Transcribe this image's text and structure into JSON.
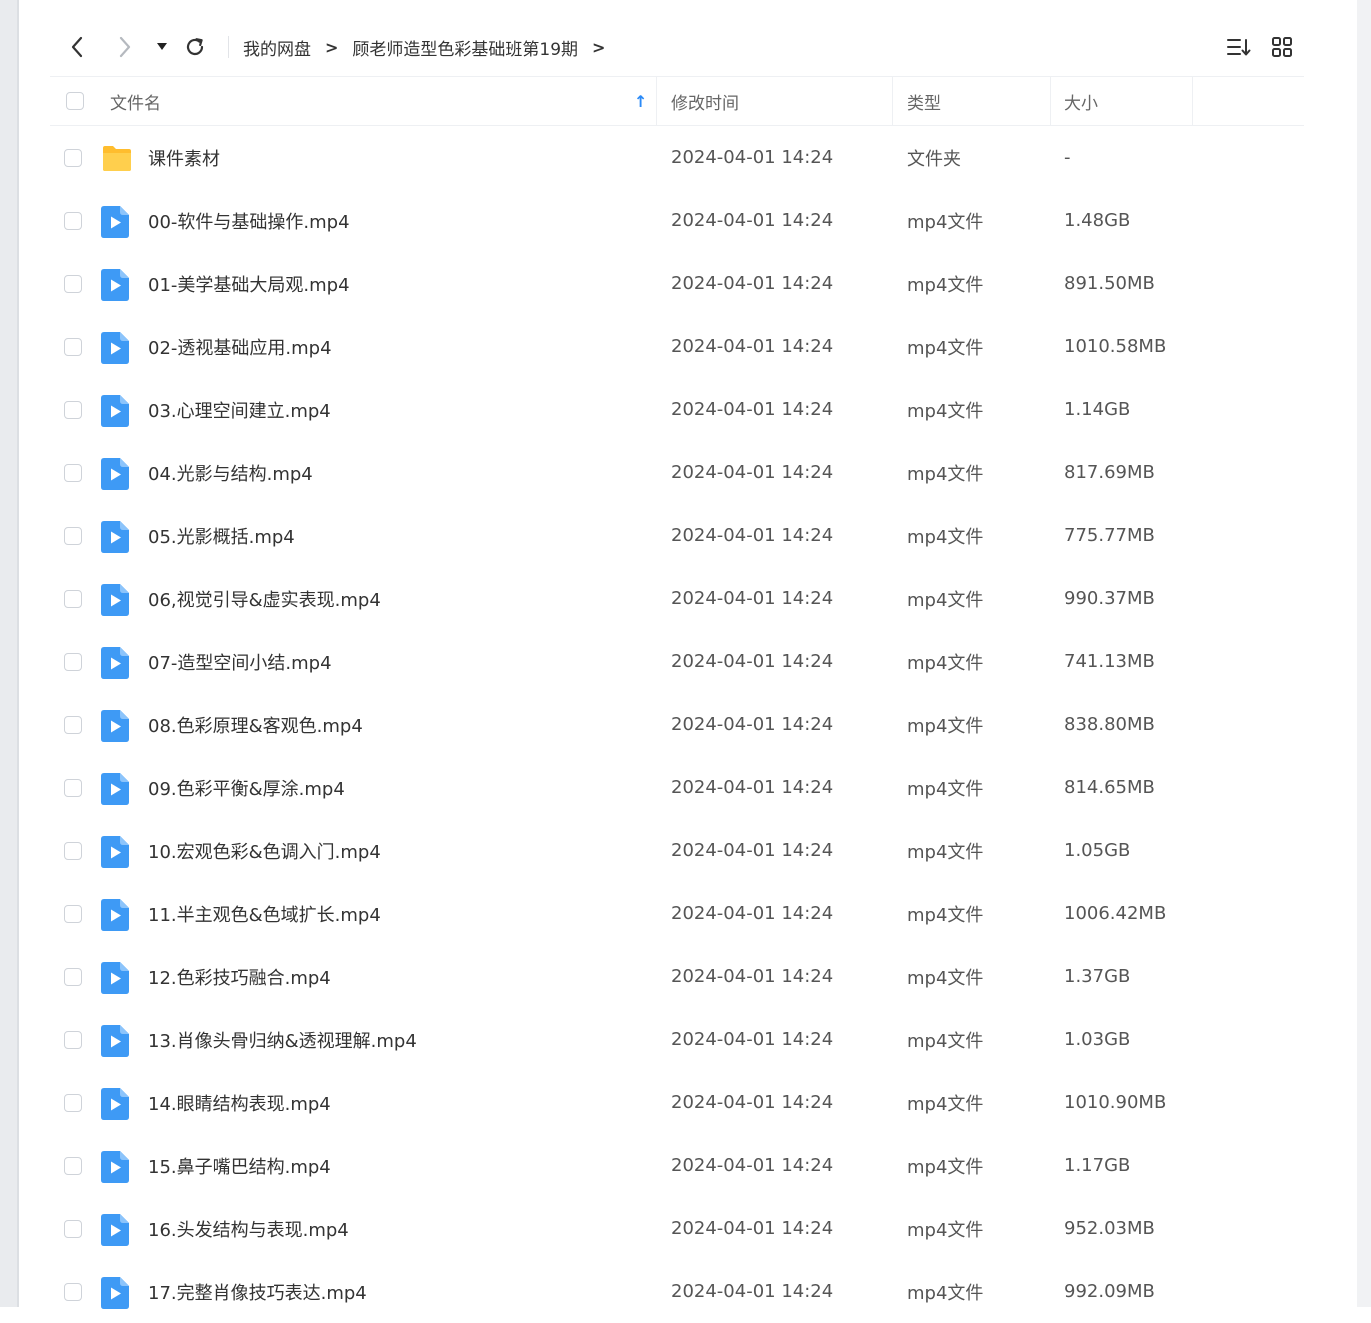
{
  "toolbar": {
    "back_icon": "chevron-left-icon",
    "forward_icon": "chevron-right-icon",
    "history_icon": "caret-down-icon",
    "refresh_icon": "refresh-icon",
    "breadcrumbs": [
      "我的网盘",
      "顾老师造型色彩基础班第19期"
    ],
    "sort_icon": "sort-list-icon",
    "view_icon": "grid-view-icon"
  },
  "table": {
    "headers": {
      "name": "文件名",
      "time": "修改时间",
      "type": "类型",
      "size": "大小"
    },
    "sort_indicator": "↑",
    "rows": [
      {
        "kind": "folder",
        "name": "课件素材",
        "time": "2024-04-01 14:24",
        "type": "文件夹",
        "size": "-"
      },
      {
        "kind": "video",
        "name": "00-软件与基础操作.mp4",
        "time": "2024-04-01 14:24",
        "type": "mp4文件",
        "size": "1.48GB"
      },
      {
        "kind": "video",
        "name": "01-美学基础大局观.mp4",
        "time": "2024-04-01 14:24",
        "type": "mp4文件",
        "size": "891.50MB"
      },
      {
        "kind": "video",
        "name": "02-透视基础应用.mp4",
        "time": "2024-04-01 14:24",
        "type": "mp4文件",
        "size": "1010.58MB"
      },
      {
        "kind": "video",
        "name": "03.心理空间建立.mp4",
        "time": "2024-04-01 14:24",
        "type": "mp4文件",
        "size": "1.14GB"
      },
      {
        "kind": "video",
        "name": "04.光影与结构.mp4",
        "time": "2024-04-01 14:24",
        "type": "mp4文件",
        "size": "817.69MB"
      },
      {
        "kind": "video",
        "name": "05.光影概括.mp4",
        "time": "2024-04-01 14:24",
        "type": "mp4文件",
        "size": "775.77MB"
      },
      {
        "kind": "video",
        "name": "06,视觉引导&虚实表现.mp4",
        "time": "2024-04-01 14:24",
        "type": "mp4文件",
        "size": "990.37MB"
      },
      {
        "kind": "video",
        "name": "07-造型空间小结.mp4",
        "time": "2024-04-01 14:24",
        "type": "mp4文件",
        "size": "741.13MB"
      },
      {
        "kind": "video",
        "name": "08.色彩原理&客观色.mp4",
        "time": "2024-04-01 14:24",
        "type": "mp4文件",
        "size": "838.80MB"
      },
      {
        "kind": "video",
        "name": "09.色彩平衡&厚涂.mp4",
        "time": "2024-04-01 14:24",
        "type": "mp4文件",
        "size": "814.65MB"
      },
      {
        "kind": "video",
        "name": "10.宏观色彩&色调入门.mp4",
        "time": "2024-04-01 14:24",
        "type": "mp4文件",
        "size": "1.05GB"
      },
      {
        "kind": "video",
        "name": "11.半主观色&色域扩长.mp4",
        "time": "2024-04-01 14:24",
        "type": "mp4文件",
        "size": "1006.42MB"
      },
      {
        "kind": "video",
        "name": "12.色彩技巧融合.mp4",
        "time": "2024-04-01 14:24",
        "type": "mp4文件",
        "size": "1.37GB"
      },
      {
        "kind": "video",
        "name": "13.肖像头骨归纳&透视理解.mp4",
        "time": "2024-04-01 14:24",
        "type": "mp4文件",
        "size": "1.03GB"
      },
      {
        "kind": "video",
        "name": "14.眼睛结构表现.mp4",
        "time": "2024-04-01 14:24",
        "type": "mp4文件",
        "size": "1010.90MB"
      },
      {
        "kind": "video",
        "name": "15.鼻子嘴巴结构.mp4",
        "time": "2024-04-01 14:24",
        "type": "mp4文件",
        "size": "1.17GB"
      },
      {
        "kind": "video",
        "name": "16.头发结构与表现.mp4",
        "time": "2024-04-01 14:24",
        "type": "mp4文件",
        "size": "952.03MB"
      },
      {
        "kind": "video",
        "name": "17.完整肖像技巧表达.mp4",
        "time": "2024-04-01 14:24",
        "type": "mp4文件",
        "size": "992.09MB"
      }
    ]
  },
  "colors": {
    "accent": "#2b8af7",
    "folder": "#ffc533",
    "video": "#3e9af5"
  }
}
